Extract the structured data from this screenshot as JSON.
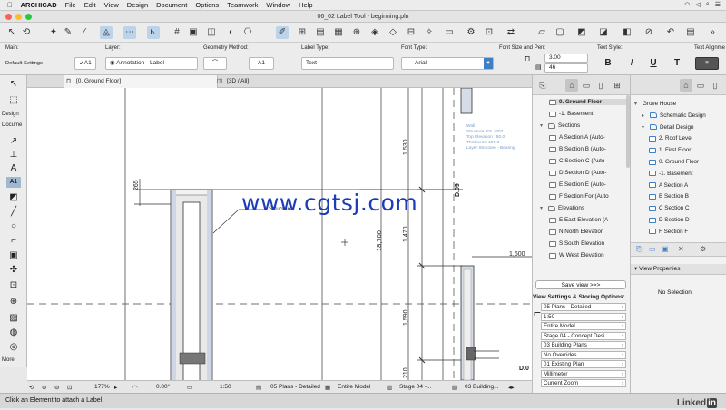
{
  "menubar": {
    "app": "ARCHICAD",
    "items": [
      "File",
      "Edit",
      "View",
      "Design",
      "Document",
      "Options",
      "Teamwork",
      "Window",
      "Help"
    ]
  },
  "window": {
    "title": "06_02 Label Tool - beginning.pln"
  },
  "infobox": {
    "main_label": "Main:",
    "default_settings": "Default Settings",
    "layer_label": "Layer:",
    "layer_value": "Annotation - Label",
    "geometry_label": "Geometry Method:",
    "label_type_label": "Label Type:",
    "label_type_value": "Text",
    "font_type_label": "Font Type:",
    "font_value": "Arial",
    "font_size_label": "Font Size and Pen:",
    "font_size_value": "3.00",
    "pen_value": "46",
    "text_style_label": "Text Style:",
    "text_align_label": "Text Alignme",
    "style_bold": "B",
    "style_italic": "I",
    "style_underline": "U",
    "style_strike": "T"
  },
  "toolbox": {
    "design_label": "Design",
    "document_label": "Docume",
    "more_label": "More",
    "label_tool_text": "A1"
  },
  "tabs": [
    {
      "label": "[0. Ground Floor]"
    },
    {
      "label": "[3D / All]"
    }
  ],
  "drawing": {
    "dim_265": "265",
    "dim_18700": "18,700",
    "dim_1530": "1,530",
    "dim_1470": "1,470",
    "dim_1590": "1,590",
    "dim_210": "210",
    "dim_1600": "1,600",
    "marker_d09": "D.09",
    "marker_d0": "D.0",
    "structure_label": "Structure",
    "watermark": "www.cgtsj.com",
    "tooltip_lines": [
      "Wall",
      "Structure IFS : 607",
      "Top Elevation : 50.0",
      "Thickness: 100.0",
      "Layer Structure - Bearing"
    ]
  },
  "canvas_status": {
    "zoom": "177%",
    "angle": "0.00°",
    "scale": "1:50",
    "layer_combo": "05 Plans - Detailed",
    "model_view": "Entire Model",
    "renovation": "Stage 04 -...",
    "penset": "03 Building..."
  },
  "navigator": {
    "items": [
      {
        "label": "0. Ground Floor",
        "indent": 1,
        "type": "floor",
        "selected": true
      },
      {
        "label": "-1. Basement",
        "indent": 1,
        "type": "floor"
      },
      {
        "label": "Sections",
        "indent": 0,
        "type": "folder",
        "caret": "▾"
      },
      {
        "label": "A Section A (Auto-",
        "indent": 1,
        "type": "doc"
      },
      {
        "label": "B Section B (Auto-",
        "indent": 1,
        "type": "doc"
      },
      {
        "label": "C Section C (Auto-",
        "indent": 1,
        "type": "doc"
      },
      {
        "label": "D Section D (Auto-",
        "indent": 1,
        "type": "doc"
      },
      {
        "label": "E Section E (Auto-",
        "indent": 1,
        "type": "doc"
      },
      {
        "label": "F Section For (Auto",
        "indent": 1,
        "type": "doc"
      },
      {
        "label": "Elevations",
        "indent": 0,
        "type": "folder",
        "caret": "▾"
      },
      {
        "label": "E East Elevation (A",
        "indent": 1,
        "type": "doc"
      },
      {
        "label": "N North Elevation",
        "indent": 1,
        "type": "doc"
      },
      {
        "label": "S South Elevation",
        "indent": 1,
        "type": "doc"
      },
      {
        "label": "W West Elevation",
        "indent": 1,
        "type": "doc"
      }
    ],
    "save_view": "Save view >>>",
    "view_settings_heading": "View Settings & Storing Options:",
    "view_settings": [
      "05 Plans - Detailed",
      "1:50",
      "Entire Model",
      "Stage 04 - Concept Desi...",
      "03 Building Plans",
      "No Overrides",
      "01 Existing Plan",
      "Millimeter",
      "Current Zoom"
    ]
  },
  "organizer": {
    "items": [
      {
        "label": "Grove House",
        "indent": 0,
        "caret": "▾"
      },
      {
        "label": "Schematic Design",
        "indent": 1,
        "caret": "▸",
        "type": "folder"
      },
      {
        "label": "Detail Design",
        "indent": 1,
        "caret": "▾",
        "type": "folder"
      },
      {
        "label": "2. Roof Level",
        "indent": 2,
        "type": "floor"
      },
      {
        "label": "1. First Floor",
        "indent": 2,
        "type": "floor"
      },
      {
        "label": "0. Ground Floor",
        "indent": 2,
        "type": "floor"
      },
      {
        "label": "-1. Basement",
        "indent": 2,
        "type": "floor"
      },
      {
        "label": "A Section A",
        "indent": 2,
        "type": "doc"
      },
      {
        "label": "B Section B",
        "indent": 2,
        "type": "doc"
      },
      {
        "label": "C Section C",
        "indent": 2,
        "type": "doc"
      },
      {
        "label": "D Section D",
        "indent": 2,
        "type": "doc"
      },
      {
        "label": "F Section F",
        "indent": 2,
        "type": "doc"
      }
    ],
    "view_properties": "View Properties",
    "no_selection": "No Selection."
  },
  "statusbar": {
    "message": "Click an Element to attach a Label."
  },
  "brand": {
    "name": "Linked",
    "suffix": "in"
  },
  "colors": {
    "accent": "#3f7fc4",
    "watermark": "#1a3cb8",
    "selected_tool": "#9fb7cf"
  }
}
